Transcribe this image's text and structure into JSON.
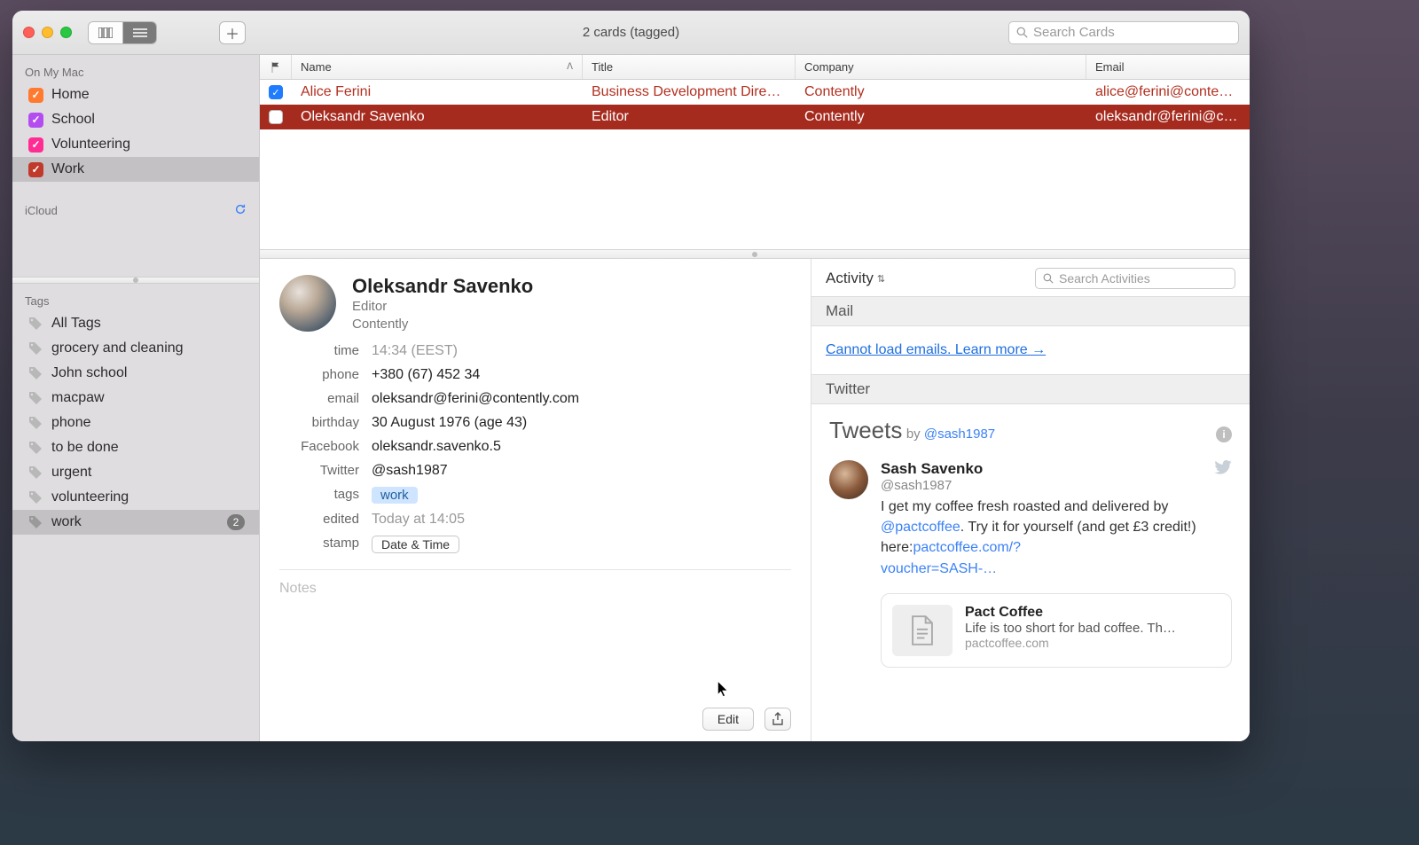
{
  "window": {
    "title": "2 cards (tagged)"
  },
  "search": {
    "placeholder": "Search Cards"
  },
  "sidebar": {
    "section1": "On My Mac",
    "groups": [
      {
        "label": "Home",
        "color": "#ff7a2f"
      },
      {
        "label": "School",
        "color": "#b44df0"
      },
      {
        "label": "Volunteering",
        "color": "#ff2d93"
      },
      {
        "label": "Work",
        "color": "#c0392b"
      }
    ],
    "section2": "iCloud",
    "tags_header": "Tags",
    "tags": [
      {
        "label": "All Tags"
      },
      {
        "label": "grocery and cleaning"
      },
      {
        "label": "John school"
      },
      {
        "label": "macpaw"
      },
      {
        "label": "phone"
      },
      {
        "label": "to be done"
      },
      {
        "label": "urgent"
      },
      {
        "label": "volunteering"
      },
      {
        "label": "work",
        "count": "2",
        "selected": true
      }
    ]
  },
  "columns": {
    "flag": "",
    "name": "Name",
    "title": "Title",
    "company": "Company",
    "email": "Email"
  },
  "rows": [
    {
      "flagged": true,
      "name": "Alice Ferini",
      "title": "Business Development Dire…",
      "company": "Contently",
      "email": "alice@ferini@contently",
      "selected": false
    },
    {
      "flagged": false,
      "name": "Oleksandr Savenko",
      "title": "Editor",
      "company": "Contently",
      "email": "oleksandr@ferini@cont",
      "selected": true
    }
  ],
  "card": {
    "name": "Oleksandr Savenko",
    "role": "Editor",
    "company": "Contently",
    "fields": {
      "time_label": "time",
      "time_value": "14:34 (EEST)",
      "phone_label": "phone",
      "phone_value": "+380 (67) 452 34",
      "email_label": "email",
      "email_value": "oleksandr@ferini@contently.com",
      "birthday_label": "birthday",
      "birthday_value": "30 August 1976 (age 43)",
      "facebook_label": "Facebook",
      "facebook_value": "oleksandr.savenko.5",
      "twitter_label": "Twitter",
      "twitter_value": "@sash1987",
      "tags_label": "tags",
      "tags_value": "work",
      "edited_label": "edited",
      "edited_value": "Today at 14:05",
      "stamp_label": "stamp",
      "stamp_value": "Date & Time"
    },
    "notes_placeholder": "Notes",
    "edit_button": "Edit"
  },
  "activity": {
    "label": "Activity",
    "search_placeholder": "Search Activities",
    "mail_header": "Mail",
    "mail_message": "Cannot load emails. Learn more →",
    "twitter_header": "Twitter",
    "tweets_title": "Tweets",
    "tweets_by": "by ",
    "tweets_handle": "@sash1987",
    "tweet": {
      "name": "Sash Savenko",
      "handle": "@sash1987",
      "text_pre": "I get my coffee fresh roasted and delivered by ",
      "mention": "@pactcoffee",
      "text_mid": ". Try it for yourself (and get £3 credit!) here:",
      "link1": "pactcoffee.com/?",
      "link2": "voucher=SASH-…"
    },
    "linkcard": {
      "title": "Pact Coffee",
      "desc": "Life is too short for bad coffee. Th…",
      "domain": "pactcoffee.com"
    }
  }
}
